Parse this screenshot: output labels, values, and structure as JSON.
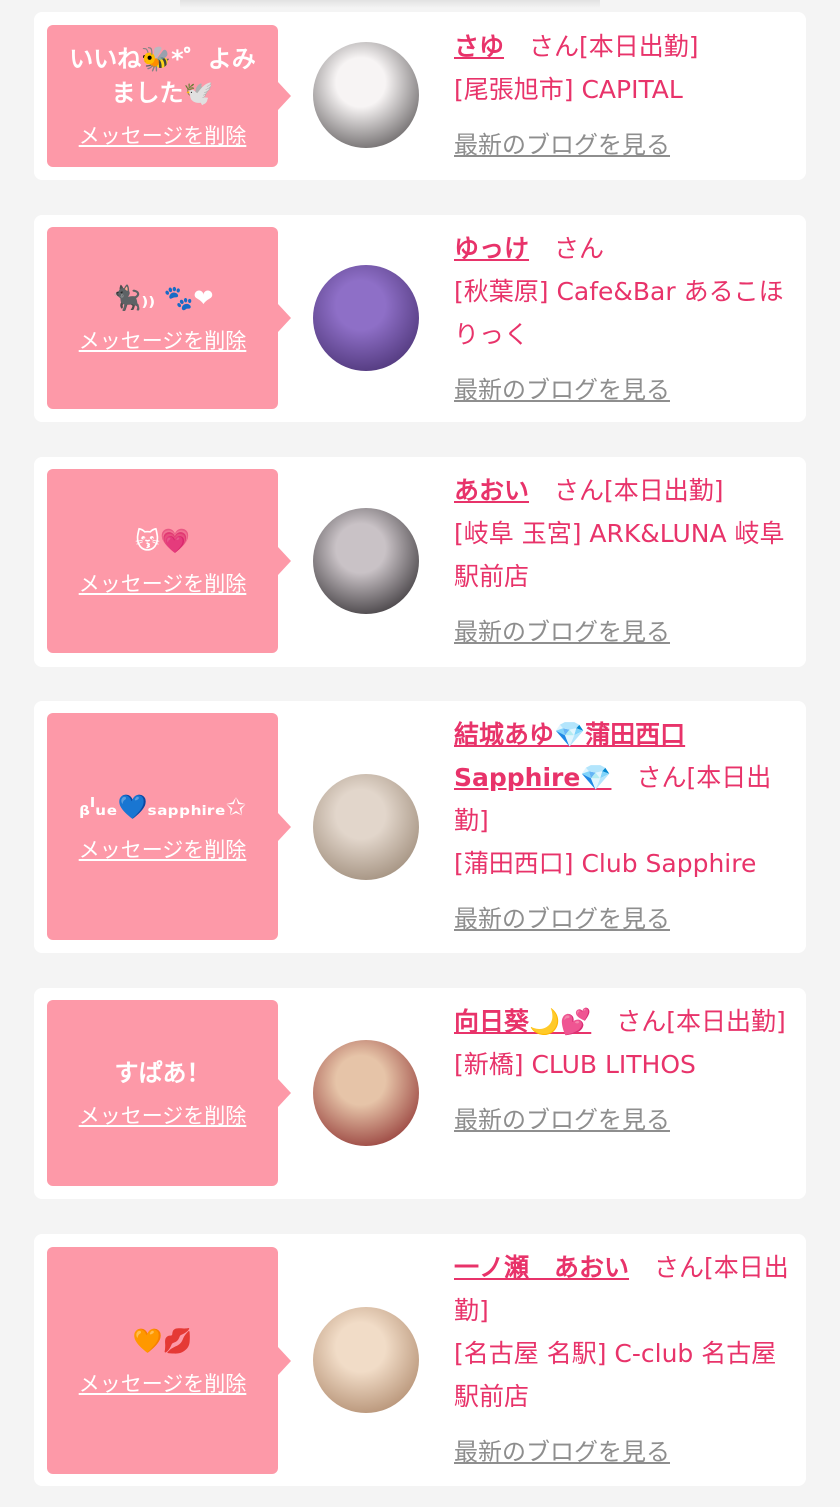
{
  "entries": [
    {
      "message": "いいね🐝*゜よみました🕊️",
      "delete_label": "メッセージを削除",
      "name": "さゆ",
      "san": "　さん",
      "status": "[本日出勤]",
      "shop": "[尾張旭市] CAPITAL",
      "blog_label": "最新のブログを見る",
      "avatar_colors": [
        "#f7f4f4",
        "#3a3637"
      ]
    },
    {
      "message": "🐈‍⬛₎₎ 🐾❤",
      "delete_label": "メッセージを削除",
      "name": "ゆっけ",
      "san": "　さん",
      "status": "",
      "shop": "[秋葉原] Cafe&Bar あるこほりっく",
      "blog_label": "最新のブログを見る",
      "avatar_colors": [
        "#8e6fc7",
        "#3a2460"
      ]
    },
    {
      "message": "😽💗",
      "delete_label": "メッセージを削除",
      "name": "あおい",
      "san": "　さん",
      "status": "[本日出勤]",
      "shop": "[岐阜 玉宮] ARK&LUNA 岐阜駅前店",
      "blog_label": "最新のブログを見る",
      "avatar_colors": [
        "#c9c2c6",
        "#141114"
      ]
    },
    {
      "message": "ᵦˡᵤₑ💙ₛₐₚₚₕᵢᵣₑ✩",
      "delete_label": "メッセージを削除",
      "name": "結城あゆ💎蒲田西口Sapphire💎",
      "san": "　さん",
      "status": "[本日出勤]",
      "shop": "[蒲田西口] Club Sapphire",
      "blog_label": "最新のブログを見る",
      "avatar_colors": [
        "#e2d6cb",
        "#8b7763"
      ]
    },
    {
      "message": "すぱあ！",
      "delete_label": "メッセージを削除",
      "name": "向日葵🌙💕",
      "san": "　さん",
      "status": "[本日出勤]",
      "shop": "[新橋] CLUB LITHOS",
      "blog_label": "最新のブログを見る",
      "avatar_colors": [
        "#e6c4a8",
        "#7d1418"
      ]
    },
    {
      "message": "🧡💋",
      "delete_label": "メッセージを削除",
      "name": "一ノ瀬　あおい",
      "san": "　さん",
      "status": "[本日出勤]",
      "shop": "[名古屋 名駅] C-club 名古屋駅前店",
      "blog_label": "最新のブログを見る",
      "avatar_colors": [
        "#f1dcc7",
        "#a07758"
      ]
    }
  ],
  "colors": {
    "background": "#f4f4f4",
    "card": "#ffffff",
    "bubble": "#fd99a8",
    "accent": "#e8336a",
    "link_gray": "#8e8e8e"
  }
}
